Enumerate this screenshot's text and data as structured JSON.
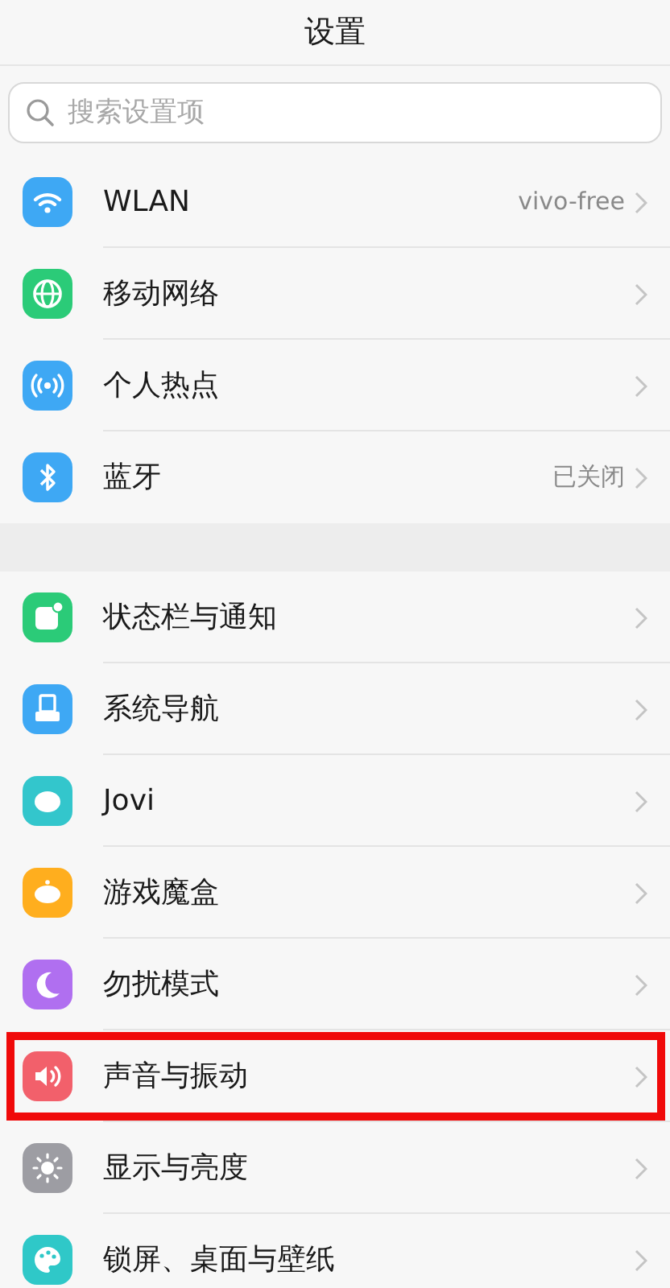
{
  "title": "设置",
  "search": {
    "placeholder": "搜索设置项"
  },
  "groups": [
    {
      "items": [
        {
          "kind": "wifi",
          "color": "#3ea8f4",
          "label": "WLAN",
          "value": "vivo-free",
          "highlighted": false
        },
        {
          "kind": "globe",
          "color": "#2bcb78",
          "label": "移动网络",
          "highlighted": false
        },
        {
          "kind": "hotspot",
          "color": "#3ea8f4",
          "label": "个人热点",
          "highlighted": false
        },
        {
          "kind": "bluetooth",
          "color": "#3ea8f4",
          "label": "蓝牙",
          "value": "已关闭",
          "highlighted": false
        }
      ]
    },
    {
      "items": [
        {
          "kind": "notification",
          "color": "#2bcb78",
          "label": "状态栏与通知",
          "highlighted": false
        },
        {
          "kind": "navigation",
          "color": "#3ea8f4",
          "label": "系统导航",
          "highlighted": false
        },
        {
          "kind": "bubble",
          "color": "#33c6cc",
          "label": "Jovi",
          "highlighted": false
        },
        {
          "kind": "gamepad",
          "color": "#ffae1e",
          "label": "游戏魔盒",
          "highlighted": false
        },
        {
          "kind": "moon",
          "color": "#b06ff0",
          "label": "勿扰模式",
          "highlighted": false
        },
        {
          "kind": "speaker",
          "color": "#f2606b",
          "label": "声音与振动",
          "highlighted": true
        },
        {
          "kind": "sun",
          "color": "#9d9da3",
          "label": "显示与亮度",
          "highlighted": false
        },
        {
          "kind": "palette",
          "color": "#2fc8c8",
          "label": "锁屏、桌面与壁纸",
          "highlighted": false
        }
      ]
    }
  ]
}
